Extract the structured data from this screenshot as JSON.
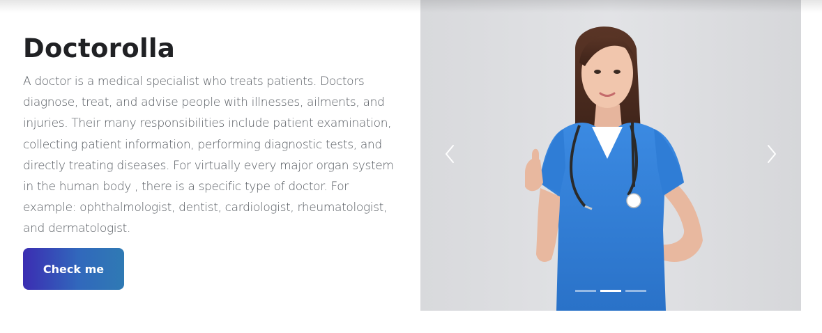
{
  "hero": {
    "title": "Doctorolla",
    "description": "A doctor is a medical specialist who treats patients. Doctors diagnose, treat, and advise people with illnesses, ailments, and injuries. Their many responsibilities include patient examination, collecting patient information, performing diagnostic tests, and directly treating diseases. For virtually every major organ system in the human body , there is a specific type of doctor. For example: ophthalmologist, dentist, cardiologist, rheumatologist, and dermatologist.",
    "button_label": "Check me"
  },
  "carousel": {
    "prev_icon": "chevron-left-icon",
    "next_icon": "chevron-right-icon",
    "active_slide": 2,
    "slide_count": 3
  },
  "colors": {
    "button_gradient_start": "#3b2db2",
    "button_gradient_end": "#2f7ab4",
    "scrubs_blue": "#2f7fd8",
    "carousel_bg": "#dcdde0"
  }
}
